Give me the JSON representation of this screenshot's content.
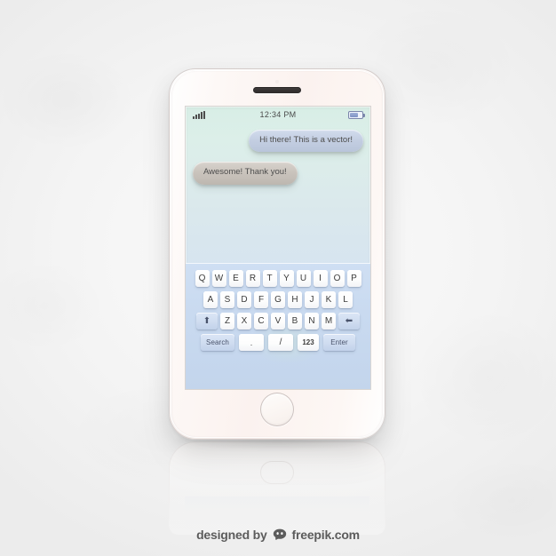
{
  "scene": {
    "background_color": "#f2f2f2",
    "device_body_color": "#fbf2ef"
  },
  "phone": {
    "speaker_icon": "speaker-grille",
    "camera_icon": "front-camera",
    "home_button_label": "Home"
  },
  "status_bar": {
    "signal_icon": "signal-bars-icon",
    "signal_bars": 5,
    "time": "12:34 PM",
    "battery_icon": "battery-icon",
    "battery_level_percent": 55
  },
  "conversation": {
    "messages": [
      {
        "text": "Hi there! This is a vector!",
        "side": "right",
        "color": "#c4cfe2",
        "bubble_style": "blue"
      },
      {
        "text": "Awesome! Thank you!",
        "side": "left",
        "color": "#cac4bd",
        "bubble_style": "grey"
      }
    ]
  },
  "keyboard": {
    "accent_color": "#c9daf0",
    "rows": [
      {
        "name": "row-1",
        "keys": [
          {
            "label": "Q",
            "name": "key-q",
            "type": "letter"
          },
          {
            "label": "W",
            "name": "key-w",
            "type": "letter"
          },
          {
            "label": "E",
            "name": "key-e",
            "type": "letter"
          },
          {
            "label": "R",
            "name": "key-r",
            "type": "letter"
          },
          {
            "label": "T",
            "name": "key-t",
            "type": "letter"
          },
          {
            "label": "Y",
            "name": "key-y",
            "type": "letter"
          },
          {
            "label": "U",
            "name": "key-u",
            "type": "letter"
          },
          {
            "label": "I",
            "name": "key-i",
            "type": "letter"
          },
          {
            "label": "O",
            "name": "key-o",
            "type": "letter"
          },
          {
            "label": "P",
            "name": "key-p",
            "type": "letter"
          }
        ]
      },
      {
        "name": "row-2",
        "keys": [
          {
            "label": "A",
            "name": "key-a",
            "type": "letter"
          },
          {
            "label": "S",
            "name": "key-s",
            "type": "letter"
          },
          {
            "label": "D",
            "name": "key-d",
            "type": "letter"
          },
          {
            "label": "F",
            "name": "key-f",
            "type": "letter"
          },
          {
            "label": "G",
            "name": "key-g",
            "type": "letter"
          },
          {
            "label": "H",
            "name": "key-h",
            "type": "letter"
          },
          {
            "label": "J",
            "name": "key-j",
            "type": "letter"
          },
          {
            "label": "K",
            "name": "key-k",
            "type": "letter"
          },
          {
            "label": "L",
            "name": "key-l",
            "type": "letter"
          }
        ]
      },
      {
        "name": "row-3",
        "keys": [
          {
            "label": "⬆",
            "name": "shift-key",
            "type": "modifier"
          },
          {
            "label": "Z",
            "name": "key-z",
            "type": "letter"
          },
          {
            "label": "X",
            "name": "key-x",
            "type": "letter"
          },
          {
            "label": "C",
            "name": "key-c",
            "type": "letter"
          },
          {
            "label": "V",
            "name": "key-v",
            "type": "letter"
          },
          {
            "label": "B",
            "name": "key-b",
            "type": "letter"
          },
          {
            "label": "N",
            "name": "key-n",
            "type": "letter"
          },
          {
            "label": "M",
            "name": "key-m",
            "type": "letter"
          },
          {
            "label": "⬅",
            "name": "backspace-key",
            "type": "modifier"
          }
        ]
      },
      {
        "name": "row-4",
        "keys": [
          {
            "label": "Search",
            "name": "search-key",
            "type": "modifier"
          },
          {
            "label": ".",
            "name": "period-key",
            "type": "letter"
          },
          {
            "label": "/",
            "name": "slash-key",
            "type": "letter"
          },
          {
            "label": "123",
            "name": "numeric-key",
            "type": "letter"
          },
          {
            "label": "Enter",
            "name": "enter-key",
            "type": "modifier"
          }
        ]
      }
    ]
  },
  "footer": {
    "prefix": "designed by",
    "logo_icon": "freepik-logo",
    "brand": "freepik.com"
  }
}
